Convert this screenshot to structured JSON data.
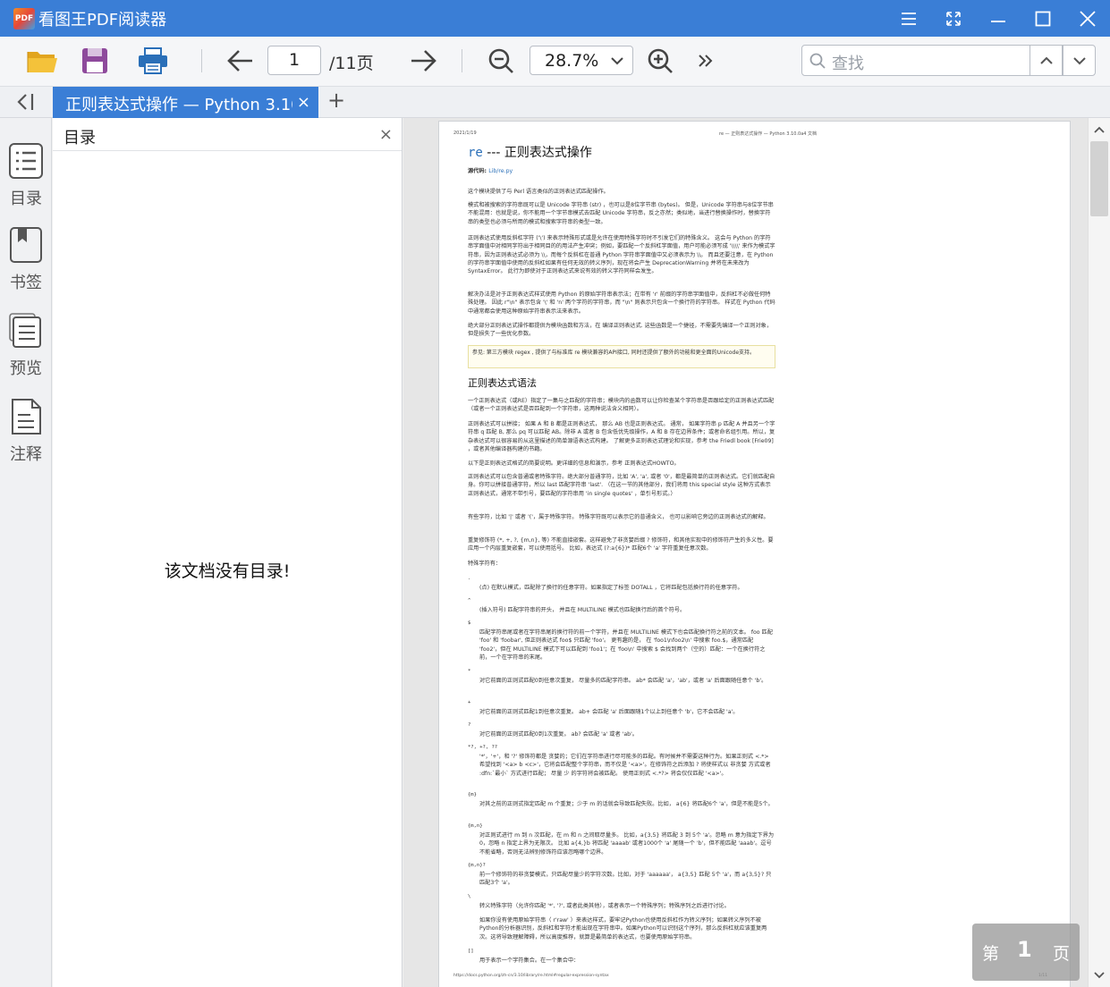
{
  "window": {
    "title": "看图王PDF阅读器",
    "logo_text": "PDF"
  },
  "toolbar": {
    "page_current": "1",
    "page_total": "/11页",
    "zoom": "28.7%",
    "search_placeholder": "查找"
  },
  "tab": {
    "label": "正则表达式操作 — Python 3.10",
    "close": "×",
    "add": "+"
  },
  "rail": [
    {
      "label": "目录",
      "icon": "list-icon"
    },
    {
      "label": "书签",
      "icon": "bookmark-icon"
    },
    {
      "label": "预览",
      "icon": "preview-icon"
    },
    {
      "label": "注释",
      "icon": "note-icon"
    }
  ],
  "toc": {
    "title": "目录",
    "close": "×",
    "empty_message": "该文档没有目录!"
  },
  "document": {
    "header_left": "2021/1/19",
    "header_right": "re — 正则表达式操作 — Python 3.10.0a4 文档",
    "title_code": "re",
    "title_text": " --- 正则表达式操作",
    "source_label": "源代码:",
    "source_link": "Lib/re.py",
    "paragraphs": [
      "这个模块提供了与 Perl 语言类似的正则表达式匹配操作。",
      "模式和被搜索的字符串既可以是 Unicode 字符串 (str) ，也可以是8位字节串 (bytes)。 但是，Unicode 字符串与8位字节串不能混用：也就是说，你不能用一个字节串模式去匹配 Unicode 字符串，反之亦然；类似地，当进行替换操作时，替换字符串的类型也必须与所用的模式和搜索字符串的类型一致。",
      "正则表达式使用反斜杠字符 ('\\') 来表示特殊形式或是允许在使用特殊字符时不引发它们的特殊含义。 这会与 Python 的字符串字面值中对相同字符出于相同目的的用法产生冲突；例如，要匹配一个反斜杠字面值，用户可能必须写成 '\\\\\\\\' 来作为模式字符串，因为正则表达式必须为 \\\\，而每个反斜杠在普通 Python 字符串字面值中又必须表示为 \\\\。 而且还要注意，在 Python 的字符串字面值中使用的反斜杠如果有任何无效的转义序列，现在将会产生 DeprecationWarning 并将在未来改为 SyntaxError。 此行为即使对于正则表达式来说有效的转义字符同样会发生。",
      "解决办法是对于正则表达式样式使用 Python 的原始字符串表示法；在带有 'r' 前缀的字符串字面值中，反斜杠不必做任何特殊处理。 因此 r\"\\n\" 表示包含 '\\' 和 'n' 两个字符的字符串，而 \"\\n\" 则表示只包含一个换行符的字符串。 样式在 Python 代码中通常都会使用这种原始字符串表示法来表示。",
      "绝大部分正则表达式操作都提供为模块函数和方法，在 编译正则表达式. 这些函数是一个捷径，不需要先编译一个正则对象，但是损失了一些优化参数。"
    ],
    "note": "参见: 第三方模块 regex , 提供了与标准库 re 模块兼容的API接口, 同时还提供了额外的功能和更全面的Unicode支持。",
    "section_title": "正则表达式语法",
    "section_paragraphs": [
      "一个正则表达式（或RE）指定了一集与之匹配的字符串；模块内的函数可以让你检查某个字符串是否跟给定的正则表达式匹配（或者一个正则表达式是否匹配到一个字符串，这两种说法含义相同）。",
      "正则表达式可以拼接； 如果 A 和 B 都是正则表达式， 那么 AB 也是正则表达式。 通常， 如果字符串 p 匹配 A 并且另一个字符串 q 匹配 B, 那么 pq 可以匹配 AB。除非 A 或者 B 包含低优先级操作，A 和 B 存在边界条件；或者命名组引用。所以，复杂表达式可以很容易的从这里描述的简单源语表达式构建。 了解更多正则表达式理论和实现，参考 the Friedl book [Frie09] ，或者其他编译器构建的书籍。",
      "以下是正则表达式格式的简要说明。更详细的信息和演示，参考 正则表达式HOWTO。",
      "正则表达式可以包含普通或者特殊字符。绝大部分普通字符，比如 'A', 'a', 或者 '0'，都是最简单的正则表达式。它们就匹配自身。你可以拼接普通字符，所以 last 匹配字符串 'last'. （在这一节的其他部分，我们将用 this special style 这种方式表示正则表达式，通常不带引号，要匹配的字符串用 'in single quotes' ，单引号形式。）",
      "有些字符，比如 '|' 或者 '('，属于特殊字符。 特殊字符既可以表示它的普通含义， 也可以影响它旁边的正则表达式的解释。",
      "重复修饰符 (*, +, ?, {m,n}, 等) 不能直接嵌套。这样避免了非贪婪后缀 ? 修饰符，和其他实现中的修饰符产生的多义性。要应用一个内层重复嵌套，可以使用括号。 比如，表达式 (?:a{6})* 匹配6个 'a' 字符重复任意次数。",
      "特殊字符有："
    ],
    "syntax": [
      {
        "sym": ".",
        "desc": "(点) 在默认模式，匹配除了换行的任意字符。如果指定了标签 DOTALL ，它将匹配包括换行符的任意字符。"
      },
      {
        "sym": "^",
        "desc": "(插入符号) 匹配字符串的开头， 并且在 MULTILINE 模式也匹配换行后的首个符号。"
      },
      {
        "sym": "$",
        "desc": "匹配字符串尾或者在字符串尾的换行符的前一个字符，并且在 MULTILINE 模式下也会匹配换行符之前的文本。 foo 匹配 'foo' 和 'foobar', 但正则表达式 foo$ 只匹配 'foo'。 更有趣的是， 在 'foo1\\nfoo2\\n' 中搜索 foo.$，通常匹配 'foo2'，但在 MULTILINE 模式下可以匹配到 'foo1'；在 'foo\\n' 中搜索 $ 会找到两个（空的）匹配：一个在换行符之前，一个在字符串的末尾。"
      },
      {
        "sym": "*",
        "desc": "对它前面的正则式匹配0到任意次重复， 尽量多的匹配字符串。 ab* 会匹配 'a'，'ab'，或者 'a' 后面跟随任意个 'b'。"
      },
      {
        "sym": "+",
        "desc": "对它前面的正则式匹配1到任意次重复。 ab+ 会匹配 'a' 后面跟随1个以上到任意个 'b'，它不会匹配 'a'。"
      },
      {
        "sym": "?",
        "desc": "对它前面的正则式匹配0到1次重复。 ab? 会匹配 'a' 或者 'ab'。"
      },
      {
        "sym": "*?, +?, ??",
        "desc": "'*'，'+'，和 '?' 修饰符都是 贪婪的；它们在字符串进行尽可能多的匹配。有时候并不需要这种行为。如果正则式 <.*> 希望找到 '<a> b <c>'，它将会匹配整个字符串，而不仅是 '<a>'。在修饰符之后添加 ? 将使样式以 非贪婪 方式或者 :dfn:`最小` 方式进行匹配； 尽量 少 的字符将会被匹配。 使用正则式 <.*?> 将会仅仅匹配 '<a>'。"
      },
      {
        "sym": "{m}",
        "desc": "对其之前的正则式指定匹配 m 个重复；少于 m 的话就会导致匹配失败。比如， a{6} 将匹配6个 'a'，但是不能是5个。"
      },
      {
        "sym": "{m,n}",
        "desc": "对正则式进行 m 到 n 次匹配，在 m 和 n 之间取尽量多。 比如，a{3,5} 将匹配 3 到 5个 'a'。忽略 m 意为指定下界为0，忽略 n 指定上界为无限次。 比如 a{4,}b 将匹配 'aaaab' 或者1000个 'a' 尾随一个 'b'，但不能匹配 'aaab'。逗号不能省略，否则无法辨别修饰符应该忽略哪个边界。"
      },
      {
        "sym": "{m,n}?",
        "desc": "前一个修饰符的非贪婪模式，只匹配尽量少的字符次数。比如，对于 'aaaaaa'， a{3,5} 匹配 5个 'a'，而 a{3,5}? 只匹配3个 'a'。"
      },
      {
        "sym": "\\",
        "desc": "转义特殊字符（允许你匹配 '*', '?', 或者此类其他），或者表示一个特殊序列；特殊序列之后进行讨论。"
      },
      {
        "sym": "",
        "desc": "如果你没有使用原始字符串（ r'raw' ）来表达样式，要牢记Python也使用反斜杠作为转义序列；如果转义序列不被Python的分析器识别，反斜杠和字符才能出现在字符串中。如果Python可以识别这个序列，那么反斜杠就应该重复两次。这将导致理解障碍，所以高度推荐，就算是最简单的表达式，也要使用原始字符串。"
      },
      {
        "sym": "[]",
        "desc": "用于表示一个字符集合。在一个集合中："
      }
    ],
    "footer_left": "https://docs.python.org/zh-cn/3.10/library/re.html#regular-expression-syntax",
    "footer_right": "1/11"
  },
  "page_indicator": {
    "prefix": "第",
    "number": "1",
    "suffix": "页"
  }
}
